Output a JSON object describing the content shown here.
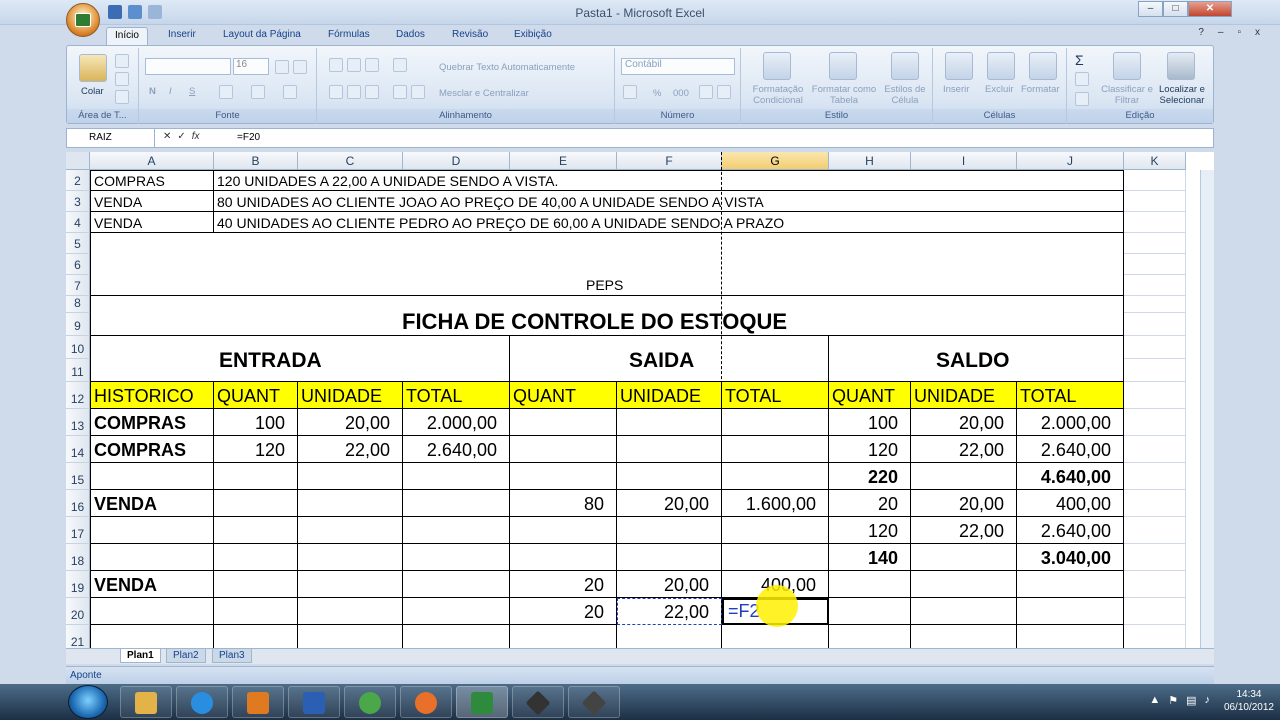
{
  "window": {
    "title": "Pasta1 - Microsoft Excel",
    "min": "–",
    "max": "□",
    "close": "✕"
  },
  "ribbon_tabs": [
    "Início",
    "Inserir",
    "Layout da Página",
    "Fórmulas",
    "Dados",
    "Revisão",
    "Exibição"
  ],
  "ribbon": {
    "clipboard": {
      "paste": "Colar",
      "label": "Área de T..."
    },
    "font": {
      "name": "",
      "size": "16",
      "bold": "N",
      "italic": "I",
      "underline": "S",
      "label": "Fonte"
    },
    "alignment": {
      "wrap": "Quebrar Texto Automaticamente",
      "merge": "Mesclar e Centralizar",
      "label": "Alinhamento"
    },
    "number": {
      "format": "Contábil",
      "percent": "%",
      "thousands": "000",
      "label": "Número"
    },
    "styles": {
      "conditional": "Formatação Condicional",
      "table": "Formatar como Tabela",
      "cell": "Estilos de Célula",
      "label": "Estilo"
    },
    "cells": {
      "insert": "Inserir",
      "delete": "Excluir",
      "format": "Formatar",
      "label": "Células"
    },
    "editing": {
      "sum": "Σ",
      "sort": "Classificar e Filtrar",
      "find": "Localizar e Selecionar",
      "label": "Edição"
    }
  },
  "formula_bar": {
    "name_box": "RAIZ",
    "fx": "fx",
    "formula": "=F20"
  },
  "columns": [
    "A",
    "B",
    "C",
    "D",
    "E",
    "F",
    "G",
    "H",
    "I",
    "J",
    "K"
  ],
  "rows": [
    "2",
    "3",
    "4",
    "5",
    "6",
    "7",
    "8",
    "9",
    "10",
    "11",
    "12",
    "13",
    "14",
    "15",
    "16",
    "17",
    "18",
    "19",
    "20",
    "21"
  ],
  "sheet": {
    "r2": {
      "a": "COMPRAS",
      "b": "120 UNIDADES A 22,00 A UNIDADE SENDO A VISTA."
    },
    "r3": {
      "a": "VENDA",
      "b": "80 UNIDADES AO CLIENTE JOAO AO PREÇO DE 40,00 A UNIDADE SENDO A VISTA"
    },
    "r4": {
      "a": "VENDA",
      "b": "40 UNIDADES AO CLIENTE PEDRO AO PREÇO DE 60,00 A UNIDADE SENDO A PRAZO"
    },
    "peps": "PEPS",
    "title": "FICHA DE CONTROLE DO ESTOQUE",
    "sections": {
      "entrada": "ENTRADA",
      "saida": "SAIDA",
      "saldo": "SALDO"
    },
    "headers": [
      "HISTORICO",
      "QUANT",
      "UNIDADE",
      "TOTAL",
      "QUANT",
      "UNIDADE",
      "TOTAL",
      "QUANT",
      "UNIDADE",
      "TOTAL"
    ],
    "data": [
      [
        "COMPRAS",
        "100",
        "20,00",
        "2.000,00",
        "",
        "",
        "",
        "100",
        "20,00",
        "2.000,00"
      ],
      [
        "COMPRAS",
        "120",
        "22,00",
        "2.640,00",
        "",
        "",
        "",
        "120",
        "22,00",
        "2.640,00"
      ],
      [
        "",
        "",
        "",
        "",
        "",
        "",
        "",
        "220",
        "",
        "4.640,00"
      ],
      [
        "VENDA",
        "",
        "",
        "",
        "80",
        "20,00",
        "1.600,00",
        "20",
        "20,00",
        "400,00"
      ],
      [
        "",
        "",
        "",
        "",
        "",
        "",
        "",
        "120",
        "22,00",
        "2.640,00"
      ],
      [
        "",
        "",
        "",
        "",
        "",
        "",
        "",
        "140",
        "",
        "3.040,00"
      ],
      [
        "VENDA",
        "",
        "",
        "",
        "20",
        "20,00",
        "400,00",
        "",
        "",
        ""
      ],
      [
        "",
        "",
        "",
        "",
        "20",
        "22,00",
        "=F2",
        "",
        "",
        ""
      ],
      [
        "",
        "",
        "",
        "",
        "",
        "",
        "",
        "",
        "",
        ""
      ]
    ]
  },
  "sheet_tabs": [
    "Plan1",
    "Plan2",
    "Plan3"
  ],
  "status": {
    "mode": "Aponte"
  },
  "taskbar": {
    "time": "14:34",
    "date": "06/10/2012"
  },
  "colors": {
    "header_fill": "#ffff00",
    "selected_col": "#f3cd6f",
    "ribbon": "#dbe6f3"
  }
}
